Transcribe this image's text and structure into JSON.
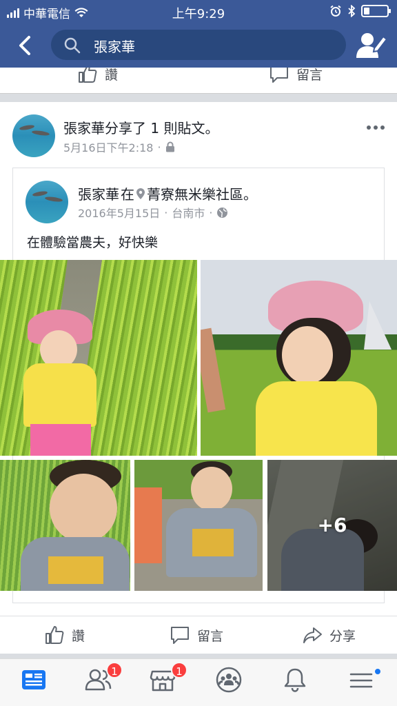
{
  "status_bar": {
    "carrier": "中華電信",
    "time": "上午9:29",
    "battery_percent": 20
  },
  "search": {
    "query": "張家華"
  },
  "previous_post": {
    "like_label": "讚",
    "comment_label": "留言"
  },
  "post": {
    "headline": "張家華分享了 1 則貼文。",
    "timestamp": "5月16日下午2:18",
    "separator": "·",
    "privacy_icon": "lock-icon",
    "shared": {
      "author": "張家華",
      "at_word": "在",
      "place": "菁寮無米樂社區。",
      "date": "2016年5月15日",
      "city": "台南市",
      "audience_icon": "globe-icon",
      "text": "在體驗當農夫，好快樂",
      "more_photos": "+6"
    },
    "actions": {
      "like": "讚",
      "comment": "留言",
      "share": "分享"
    }
  },
  "bottom_nav": {
    "friend_requests_badge": "1",
    "marketplace_badge": "1"
  },
  "colors": {
    "brand": "#3b5998",
    "badge": "#fa3e3e"
  }
}
